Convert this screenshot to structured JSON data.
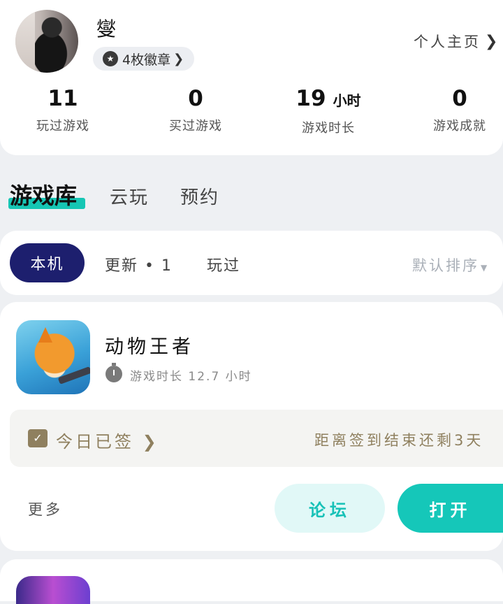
{
  "profile": {
    "username": "燮",
    "badges_label": "4枚徽章",
    "homepage_label": "个人主页",
    "stats": [
      {
        "value": "11",
        "unit": "",
        "label": "玩过游戏"
      },
      {
        "value": "0",
        "unit": "",
        "label": "买过游戏"
      },
      {
        "value": "19",
        "unit": "小时",
        "label": "游戏时长"
      },
      {
        "value": "0",
        "unit": "",
        "label": "游戏成就"
      }
    ]
  },
  "main_tabs": {
    "active": "游戏库",
    "others": [
      "云玩",
      "预约"
    ]
  },
  "filters": {
    "active": "本机",
    "update": "更新 • 1",
    "played": "玩过",
    "sort": "默认排序"
  },
  "game": {
    "title": "动物王者",
    "playtime": "游戏时长 12.7 小时",
    "checkin": "今日已签",
    "checkin_remaining": "距离签到结束还剩3天",
    "more": "更多",
    "forum": "论坛",
    "open": "打开"
  },
  "colors": {
    "accent": "#16c6b4",
    "chip_active": "#1d1f6e",
    "checkin_text": "#8f805f"
  },
  "icons": {
    "badge": "medal-icon",
    "chevron": "chevron-right-icon",
    "timer": "stopwatch-icon",
    "checkin": "calendar-check-icon",
    "sort": "caret-down-icon"
  }
}
